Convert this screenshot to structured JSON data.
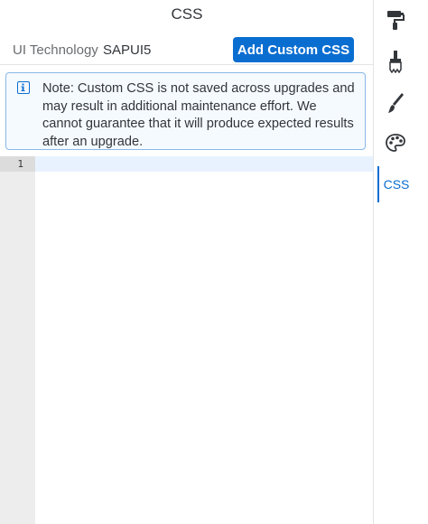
{
  "panel": {
    "title": "CSS",
    "tech_label": "UI Technology",
    "tech_value": "SAPUI5",
    "add_button_label": "Add Custom CSS"
  },
  "note": {
    "icon": "info-icon",
    "text": "Note: Custom CSS is not saved across upgrades and may result in additional maintenance effort. We cannot guarantee that it will produce expected results after an upgrade."
  },
  "editor": {
    "line_number": "1"
  },
  "sidebar": {
    "items": [
      {
        "icon": "paint-roller-icon"
      },
      {
        "icon": "paint-brush-icon"
      },
      {
        "icon": "pen-brush-icon"
      },
      {
        "icon": "palette-icon"
      },
      {
        "label": "CSS",
        "active": true
      }
    ]
  },
  "colors": {
    "accent": "#0a6ed1",
    "note_background": "#f5faff",
    "note_border": "#89b9e6",
    "gutter": "#ededed",
    "active_line": "#e8f2ff"
  }
}
